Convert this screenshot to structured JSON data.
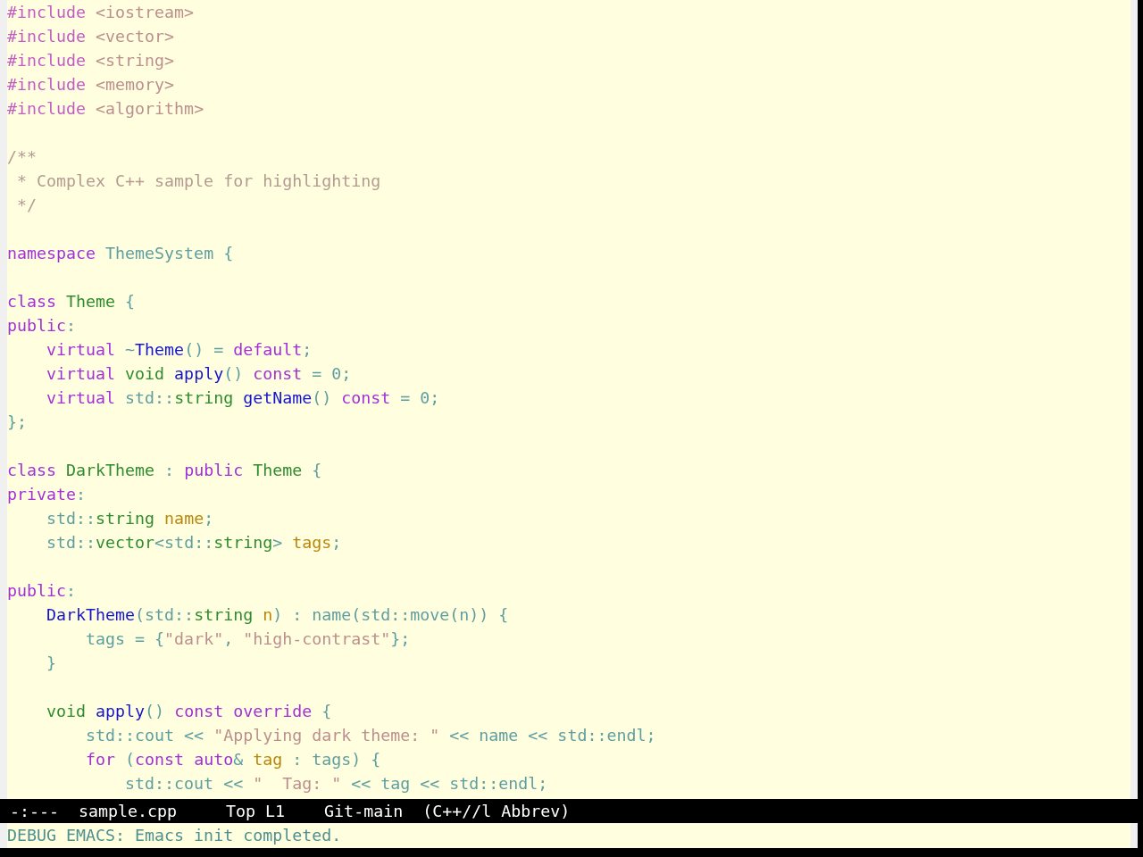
{
  "editor": {
    "blocks": [
      {
        "lines": [
          {
            "tokens": [
              {
                "kind": "preprocessor",
                "text": "#include"
              },
              {
                "kind": "string",
                "text": " <iostream>"
              }
            ]
          },
          {
            "tokens": [
              {
                "kind": "preprocessor",
                "text": "#include"
              },
              {
                "kind": "string",
                "text": " <vector>"
              }
            ]
          },
          {
            "tokens": [
              {
                "kind": "preprocessor",
                "text": "#include"
              },
              {
                "kind": "string",
                "text": " <string>"
              }
            ]
          },
          {
            "tokens": [
              {
                "kind": "preprocessor",
                "text": "#include"
              },
              {
                "kind": "string",
                "text": " <memory>"
              }
            ]
          },
          {
            "tokens": [
              {
                "kind": "preprocessor",
                "text": "#include"
              },
              {
                "kind": "string",
                "text": " <algorithm>"
              }
            ]
          }
        ]
      },
      {
        "lines": [
          {
            "tokens": [
              {
                "kind": "comment",
                "text": "/**"
              }
            ]
          },
          {
            "tokens": [
              {
                "kind": "comment",
                "text": " * Complex C++ sample for highlighting"
              }
            ]
          },
          {
            "tokens": [
              {
                "kind": "comment",
                "text": " */"
              }
            ]
          }
        ]
      },
      {
        "lines": [
          {
            "tokens": [
              {
                "kind": "keyword",
                "text": "namespace"
              },
              {
                "kind": "plain",
                "text": " ThemeSystem {"
              }
            ]
          }
        ]
      },
      {
        "lines": [
          {
            "tokens": [
              {
                "kind": "keyword",
                "text": "class"
              },
              {
                "kind": "type",
                "text": " Theme"
              },
              {
                "kind": "plain",
                "text": " {"
              }
            ]
          },
          {
            "tokens": [
              {
                "kind": "keyword",
                "text": "public"
              },
              {
                "kind": "plain",
                "text": ":"
              }
            ]
          },
          {
            "tokens": [
              {
                "kind": "keyword",
                "text": "    virtual"
              },
              {
                "kind": "plain",
                "text": " ~"
              },
              {
                "kind": "function",
                "text": "Theme"
              },
              {
                "kind": "plain",
                "text": "() = "
              },
              {
                "kind": "keyword",
                "text": "default"
              },
              {
                "kind": "plain",
                "text": ";"
              }
            ]
          },
          {
            "tokens": [
              {
                "kind": "keyword",
                "text": "    virtual"
              },
              {
                "kind": "type",
                "text": " void"
              },
              {
                "kind": "function",
                "text": " apply"
              },
              {
                "kind": "plain",
                "text": "()"
              },
              {
                "kind": "keyword",
                "text": " const"
              },
              {
                "kind": "plain",
                "text": " = 0;"
              }
            ]
          },
          {
            "tokens": [
              {
                "kind": "keyword",
                "text": "    virtual"
              },
              {
                "kind": "plain",
                "text": " std::"
              },
              {
                "kind": "type",
                "text": "string"
              },
              {
                "kind": "function",
                "text": " getName"
              },
              {
                "kind": "plain",
                "text": "()"
              },
              {
                "kind": "keyword",
                "text": " const"
              },
              {
                "kind": "plain",
                "text": " = 0;"
              }
            ]
          },
          {
            "tokens": [
              {
                "kind": "plain",
                "text": "};"
              }
            ]
          }
        ]
      },
      {
        "lines": [
          {
            "tokens": [
              {
                "kind": "keyword",
                "text": "class"
              },
              {
                "kind": "type",
                "text": " DarkTheme"
              },
              {
                "kind": "plain",
                "text": " : "
              },
              {
                "kind": "keyword",
                "text": "public"
              },
              {
                "kind": "type",
                "text": " Theme"
              },
              {
                "kind": "plain",
                "text": " {"
              }
            ]
          },
          {
            "tokens": [
              {
                "kind": "keyword",
                "text": "private"
              },
              {
                "kind": "plain",
                "text": ":"
              }
            ]
          },
          {
            "tokens": [
              {
                "kind": "plain",
                "text": "    std::"
              },
              {
                "kind": "type",
                "text": "string"
              },
              {
                "kind": "variable",
                "text": " name"
              },
              {
                "kind": "plain",
                "text": ";"
              }
            ]
          },
          {
            "tokens": [
              {
                "kind": "plain",
                "text": "    std::"
              },
              {
                "kind": "type",
                "text": "vector"
              },
              {
                "kind": "plain",
                "text": "<std::"
              },
              {
                "kind": "type",
                "text": "string"
              },
              {
                "kind": "plain",
                "text": ">"
              },
              {
                "kind": "variable",
                "text": " tags"
              },
              {
                "kind": "plain",
                "text": ";"
              }
            ]
          }
        ]
      },
      {
        "lines": [
          {
            "tokens": [
              {
                "kind": "keyword",
                "text": "public"
              },
              {
                "kind": "plain",
                "text": ":"
              }
            ]
          },
          {
            "tokens": [
              {
                "kind": "function",
                "text": "    DarkTheme"
              },
              {
                "kind": "plain",
                "text": "(std::"
              },
              {
                "kind": "type",
                "text": "string"
              },
              {
                "kind": "variable",
                "text": " n"
              },
              {
                "kind": "plain",
                "text": ") : name(std::move(n)) {"
              }
            ]
          },
          {
            "tokens": [
              {
                "kind": "plain",
                "text": "        tags = {"
              },
              {
                "kind": "string",
                "text": "\"dark\""
              },
              {
                "kind": "plain",
                "text": ", "
              },
              {
                "kind": "string",
                "text": "\"high-contrast\""
              },
              {
                "kind": "plain",
                "text": "};"
              }
            ]
          },
          {
            "tokens": [
              {
                "kind": "plain",
                "text": "    }"
              }
            ]
          }
        ]
      },
      {
        "lines": [
          {
            "tokens": [
              {
                "kind": "type",
                "text": "    void"
              },
              {
                "kind": "function",
                "text": " apply"
              },
              {
                "kind": "plain",
                "text": "()"
              },
              {
                "kind": "keyword",
                "text": " const"
              },
              {
                "kind": "keyword",
                "text": " override"
              },
              {
                "kind": "plain",
                "text": " {"
              }
            ]
          },
          {
            "tokens": [
              {
                "kind": "plain",
                "text": "        std::cout << "
              },
              {
                "kind": "string",
                "text": "\"Applying dark theme: \""
              },
              {
                "kind": "plain",
                "text": " << name << std::endl;"
              }
            ]
          },
          {
            "tokens": [
              {
                "kind": "keyword",
                "text": "        for"
              },
              {
                "kind": "plain",
                "text": " ("
              },
              {
                "kind": "keyword",
                "text": "const"
              },
              {
                "kind": "keyword",
                "text": " auto"
              },
              {
                "kind": "plain",
                "text": "&"
              },
              {
                "kind": "variable",
                "text": " tag"
              },
              {
                "kind": "plain",
                "text": " : tags) {"
              }
            ]
          },
          {
            "tokens": [
              {
                "kind": "plain",
                "text": "            std::cout << "
              },
              {
                "kind": "string",
                "text": "\"  Tag: \""
              },
              {
                "kind": "plain",
                "text": " << tag << std::endl;"
              }
            ]
          }
        ]
      }
    ]
  },
  "mode_line": {
    "status": "-:---",
    "buffer_name": "sample.cpp",
    "position": "Top L1",
    "vc_branch": "Git-main",
    "modes": "(C++//l Abbrev)"
  },
  "echo_area": {
    "message": "DEBUG EMACS: Emacs init completed."
  }
}
